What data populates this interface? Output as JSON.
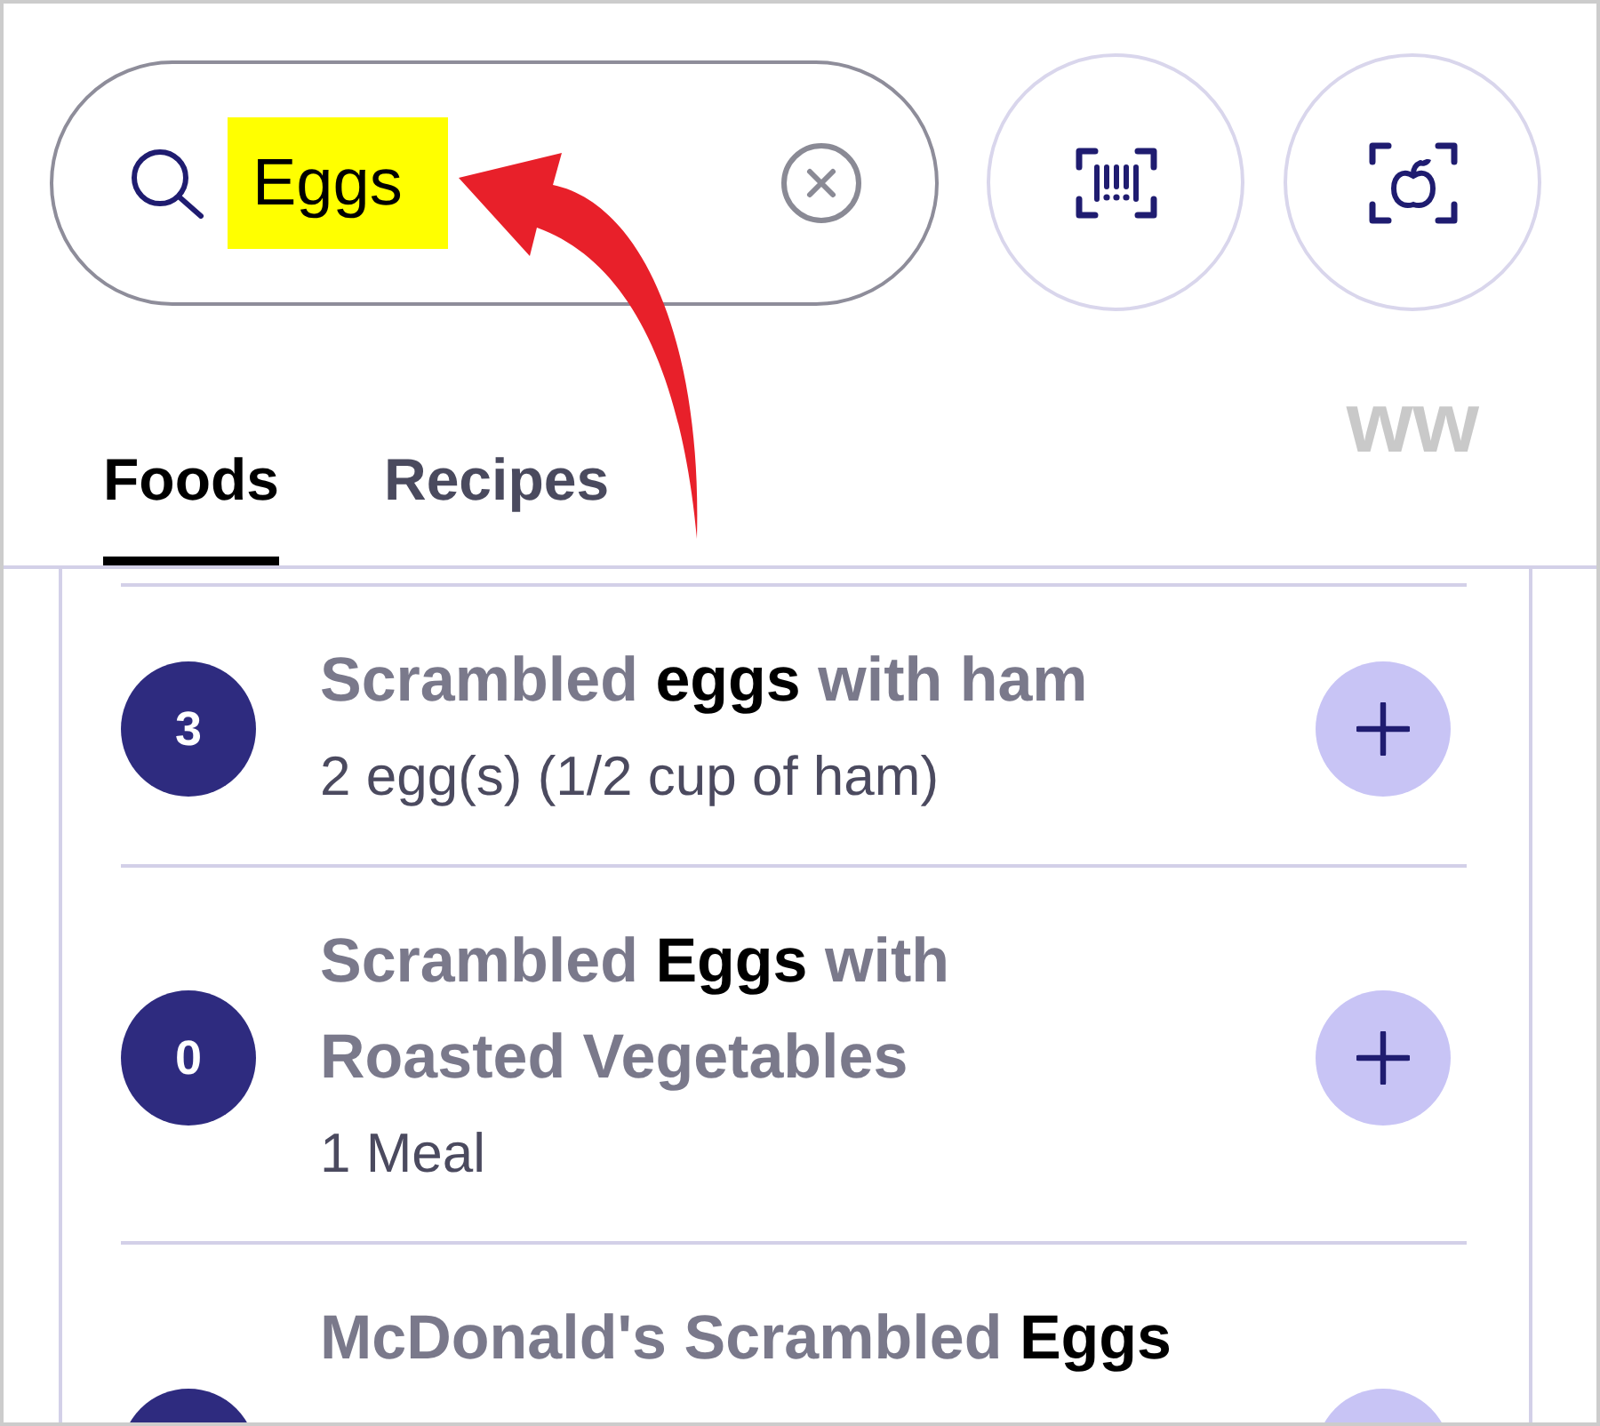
{
  "search": {
    "value": "Eggs",
    "highlighted": true
  },
  "logo": "ww",
  "tabs": [
    {
      "label": "Foods",
      "selected": true
    },
    {
      "label": "Recipes",
      "selected": false
    }
  ],
  "results": [
    {
      "count": "3",
      "title": "Scrambled **eggs** with ham",
      "detail": "2 egg(s) (1/2 cup of ham)"
    },
    {
      "count": "0",
      "title": "Scrambled **Eggs** with Roasted Vegetables",
      "detail": "1 Meal"
    },
    {
      "title": "McDonald's Scrambled **Eggs**"
    }
  ]
}
